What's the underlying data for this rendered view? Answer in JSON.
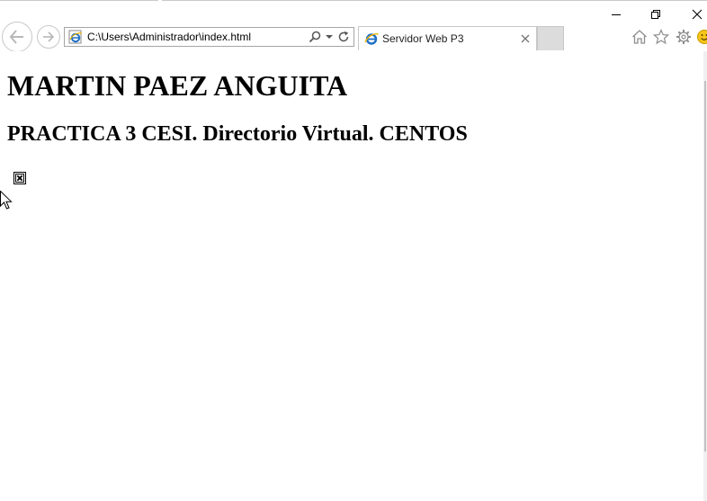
{
  "browser": {
    "address": "C:\\Users\\Administrador\\index.html",
    "tab": {
      "title": "Servidor Web P3"
    },
    "window_controls": [
      "minimize-icon",
      "restore-icon",
      "close-icon"
    ],
    "toolbar_icons": [
      "home-icon",
      "favorites-star-icon",
      "settings-gear-icon",
      "feedback-smiley-icon"
    ],
    "nav_icons": [
      "back-arrow-icon",
      "forward-arrow-icon"
    ],
    "address_tools": [
      "search-icon",
      "dropdown-icon",
      "refresh-icon"
    ],
    "accent_color": "#1e6fc8"
  },
  "page": {
    "heading1": "MARTIN PAEZ ANGUITA",
    "heading2": "PRACTICA 3 CESI. Directorio Virtual. CENTOS",
    "image": {
      "state": "broken-image-icon"
    }
  }
}
